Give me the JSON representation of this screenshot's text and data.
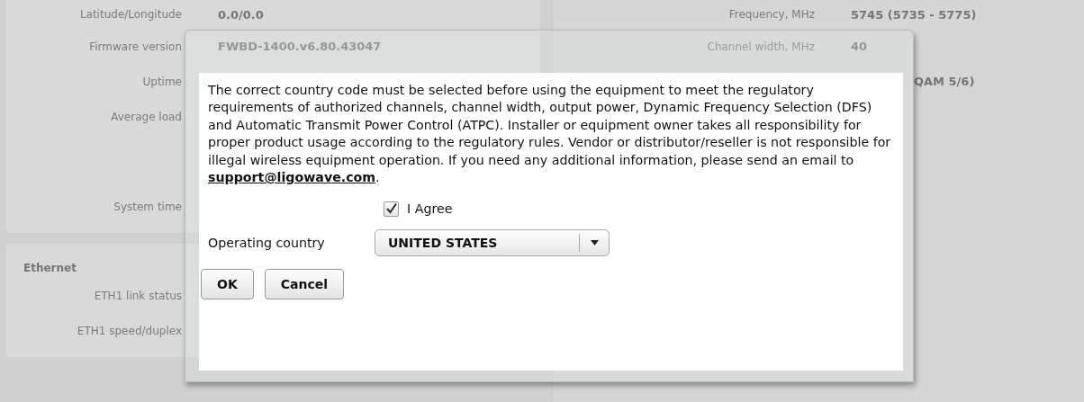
{
  "status_left": {
    "rows": [
      {
        "label": "Latitude/Longitude",
        "value": "0.0/0.0"
      },
      {
        "label": "Firmware version",
        "value": "FWBD-1400.v6.80.43047"
      },
      {
        "label": "Uptime",
        "value": ""
      },
      {
        "label": "Average load",
        "value": ""
      },
      {
        "label": "System time",
        "value": ""
      }
    ]
  },
  "ethernet": {
    "title": "Ethernet",
    "rows": [
      {
        "label": "ETH1 link status"
      },
      {
        "label": "ETH1 speed/duplex"
      }
    ]
  },
  "status_right": {
    "rows": [
      {
        "label": "Frequency, MHz",
        "value": "5745 (5735 - 5775)"
      },
      {
        "label": "Channel width, MHz",
        "value": "40"
      },
      {
        "label": "",
        "value": "QAM 5/6)"
      }
    ]
  },
  "dialog": {
    "notice_before": "The correct country code must be selected before using the equipment to meet the regulatory requirements of authorized channels, channel width, output power, Dynamic Frequency Selection (DFS) and Automatic Transmit Power Control (ATPC). Installer or equipment owner takes all responsibility for proper product usage according to the regulatory rules. Vendor or distributor/reseller is not responsible for illegal wireless equipment operation. If you need any additional information, please send an email to",
    "link": "support@ligowave.com",
    "notice_after": ".",
    "agree": {
      "label": "I Agree",
      "checked": true
    },
    "country": {
      "label": "Operating country",
      "value": "UNITED STATES"
    },
    "buttons": [
      "OK",
      "Cancel"
    ]
  }
}
